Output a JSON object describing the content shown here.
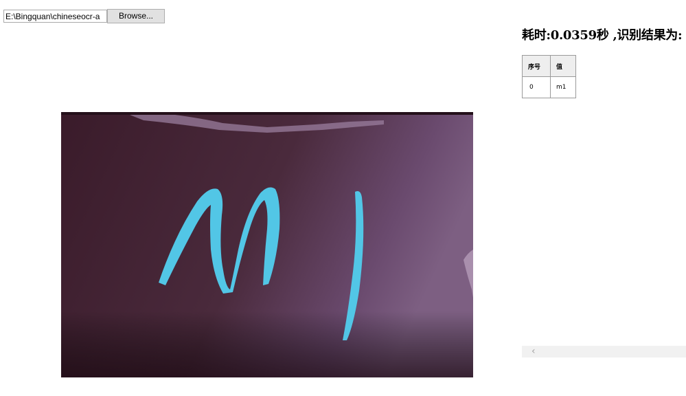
{
  "file_input": {
    "path_value": "E:\\Bingquan\\chineseocr-a",
    "browse_label": "Browse..."
  },
  "preview": {
    "handwritten_text": "m1",
    "colors": {
      "background_dark": "#3c1e2c",
      "background_light": "#7d5f82",
      "ink": "#52c6e6"
    }
  },
  "result": {
    "heading": "耗时:0.0359秒 ,识别结果为:",
    "columns": [
      "序号",
      "值"
    ],
    "rows": [
      {
        "index": "0",
        "value": "m1"
      }
    ]
  },
  "scrollbar": {
    "left_arrow_icon": "chevron-left-icon"
  }
}
